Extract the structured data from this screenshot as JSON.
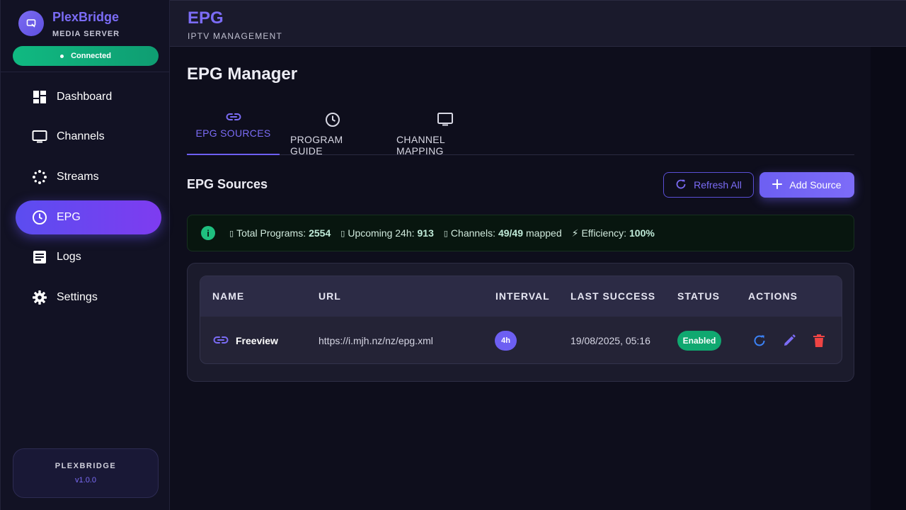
{
  "sidebar": {
    "brand": {
      "name": "PlexBridge",
      "subtitle": "MEDIA SERVER"
    },
    "connection_status": "Connected",
    "items": [
      {
        "label": "Dashboard",
        "icon": "dashboard-icon"
      },
      {
        "label": "Channels",
        "icon": "tv-icon"
      },
      {
        "label": "Streams",
        "icon": "spinner-icon"
      },
      {
        "label": "EPG",
        "icon": "clock-icon",
        "active": true
      },
      {
        "label": "Logs",
        "icon": "document-icon"
      },
      {
        "label": "Settings",
        "icon": "gear-icon"
      }
    ],
    "footer": {
      "name": "PLEXBRIDGE",
      "version": "v1.0.0"
    }
  },
  "header": {
    "title": "EPG",
    "subtitle": "IPTV MANAGEMENT"
  },
  "main": {
    "title": "EPG Manager",
    "tabs": [
      {
        "label": "EPG SOURCES",
        "icon": "link-icon",
        "active": true
      },
      {
        "label": "PROGRAM GUIDE",
        "icon": "clock-icon"
      },
      {
        "label": "CHANNEL MAPPING",
        "icon": "tv-icon"
      }
    ],
    "section_title": "EPG Sources",
    "refresh_label": "Refresh All",
    "add_label": "Add Source",
    "stats": {
      "programs_label": "Total Programs:",
      "programs_value": "2554",
      "upcoming_label": "Upcoming 24h:",
      "upcoming_value": "913",
      "channels_label": "Channels:",
      "channels_value": "49/49",
      "channels_suffix": "mapped",
      "efficiency_glyph": "⚡",
      "efficiency_label": "Efficiency:",
      "efficiency_value": "100%"
    },
    "table": {
      "columns": [
        "NAME",
        "URL",
        "INTERVAL",
        "LAST SUCCESS",
        "STATUS",
        "ACTIONS"
      ],
      "rows": [
        {
          "name": "Freeview",
          "url": "https://i.mjh.nz/nz/epg.xml",
          "interval": "4h",
          "last_success": "19/08/2025, 05:16",
          "status": "Enabled"
        }
      ]
    }
  },
  "colors": {
    "accent": "#6d5ff2",
    "success": "#10b981",
    "danger": "#ef4444",
    "refresh_action": "#3b82f6"
  }
}
